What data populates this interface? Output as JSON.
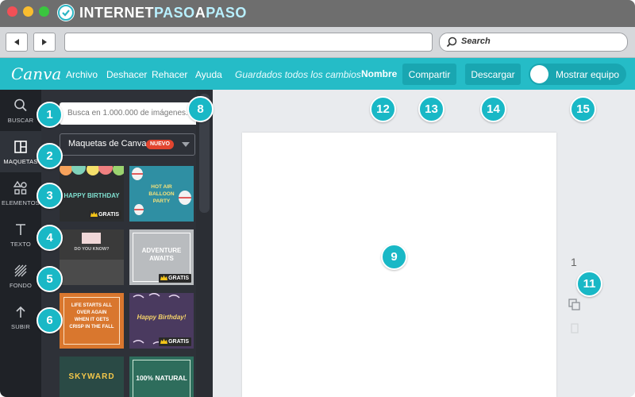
{
  "browser": {
    "site_name_part1": "INTERNET",
    "site_name_part2": "PASO",
    "site_name_part3": "A",
    "site_name_part4": "PASO",
    "search_placeholder": "Search"
  },
  "canva_bar": {
    "logo": "Canva",
    "menu": [
      "Archivo",
      "Deshacer",
      "Rehacer",
      "Ayuda"
    ],
    "saved_status": "Guardados todos los cambios",
    "name_label": "Nombre",
    "share_button": "Compartir",
    "download_button": "Descargar",
    "team_toggle": "Mostrar equipo"
  },
  "sidebar": {
    "items": [
      {
        "label": "BUSCAR",
        "icon": "search-icon"
      },
      {
        "label": "MAQUETAS",
        "icon": "layouts-icon"
      },
      {
        "label": "ELEMENTOS",
        "icon": "shapes-icon"
      },
      {
        "label": "TEXTO",
        "icon": "text-icon"
      },
      {
        "label": "FONDO",
        "icon": "background-icon"
      },
      {
        "label": "SUBIR",
        "icon": "upload-icon"
      }
    ],
    "active_index": 1
  },
  "panel": {
    "search_placeholder": "Busca en 1.000.000 de imágenes...",
    "dropdown_label": "Maquetas de Canva",
    "new_badge": "NUEVO",
    "free_badge": "GRATIS",
    "templates": [
      {
        "text": "HAPPY BIRTHDAY",
        "free": true
      },
      {
        "text": "HOT AIR BALLOON PARTY",
        "free": false
      },
      {
        "text": "DO YOU KNOW?",
        "free": false
      },
      {
        "text": "ADVENTURE AWAITS",
        "free": true
      },
      {
        "text": "LIFE STARTS ALL OVER AGAIN WHEN IT GETS CRISP IN THE FALL",
        "free": false
      },
      {
        "text": "Happy Birthday!",
        "free": true
      },
      {
        "text": "SKYWARD",
        "free": false
      },
      {
        "text": "100% NATURAL",
        "free": false
      }
    ]
  },
  "canvas": {
    "page_number": "1"
  },
  "markers": [
    "1",
    "2",
    "3",
    "4",
    "5",
    "6",
    "8",
    "9",
    "11",
    "12",
    "13",
    "14",
    "15"
  ],
  "colors": {
    "canva_teal": "#25bcc7",
    "button_teal": "#19a6b1",
    "marker": "#19b8c6",
    "sidebar_dark": "#1f2227",
    "panel_dark": "#2e3138",
    "badge_red": "#e2452f"
  }
}
